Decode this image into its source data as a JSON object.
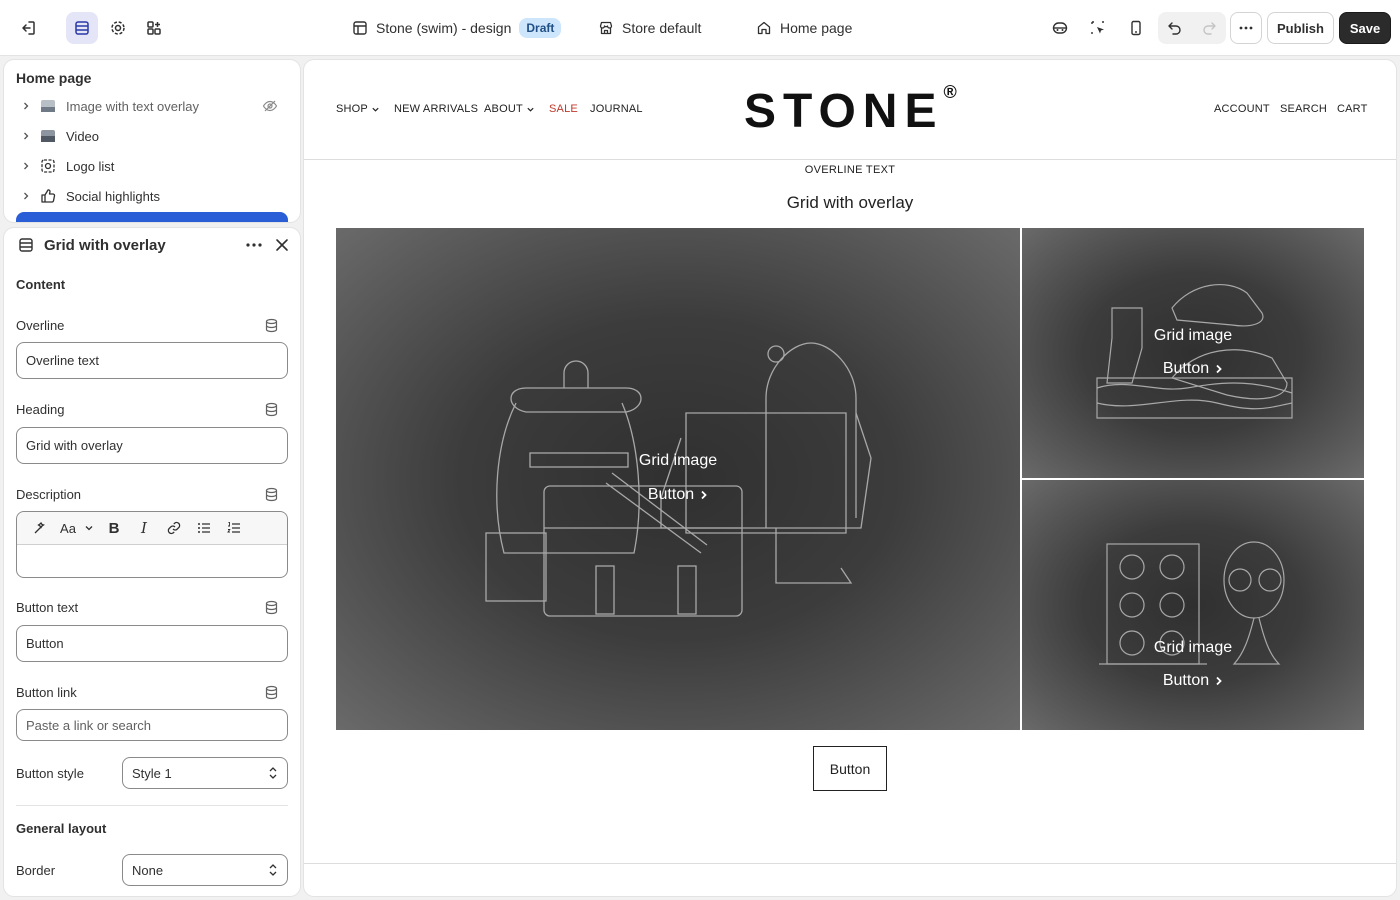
{
  "topbar": {
    "theme_name": "Stone (swim) - design",
    "theme_badge": "Draft",
    "store_label": "Store default",
    "page_label": "Home page",
    "publish_label": "Publish",
    "save_label": "Save"
  },
  "sidebar": {
    "title": "Home page",
    "items": [
      {
        "label": "Image with text overlay",
        "icon": "image-icon",
        "hidden": true
      },
      {
        "label": "Video",
        "icon": "video-icon"
      },
      {
        "label": "Logo list",
        "icon": "logo-list-icon"
      },
      {
        "label": "Social highlights",
        "icon": "thumbs-up-icon"
      }
    ]
  },
  "settings": {
    "title": "Grid with overlay",
    "content_heading": "Content",
    "overline_label": "Overline",
    "overline_value": "Overline text",
    "heading_label": "Heading",
    "heading_value": "Grid with overlay",
    "description_label": "Description",
    "button_text_label": "Button text",
    "button_text_value": "Button",
    "button_link_label": "Button link",
    "button_link_placeholder": "Paste a link or search",
    "button_style_label": "Button style",
    "button_style_value": "Style 1",
    "general_layout_heading": "General layout",
    "border_label": "Border",
    "border_value": "None"
  },
  "preview": {
    "nav": [
      "SHOP",
      "NEW ARRIVALS",
      "ABOUT",
      "SALE",
      "JOURNAL"
    ],
    "logo": "STONE",
    "logo_mark": "®",
    "nav_right": [
      "ACCOUNT",
      "SEARCH",
      "CART"
    ],
    "overline": "OVERLINE TEXT",
    "heading": "Grid with overlay",
    "tiles": [
      {
        "title": "Grid image",
        "button": "Button"
      },
      {
        "title": "Grid image",
        "button": "Button"
      },
      {
        "title": "Grid image",
        "button": "Button"
      }
    ],
    "main_button": "Button"
  },
  "colors": {
    "accent": "#2a5ed6",
    "sale": "#c0392b",
    "draft_badge": "#cde6fc"
  }
}
